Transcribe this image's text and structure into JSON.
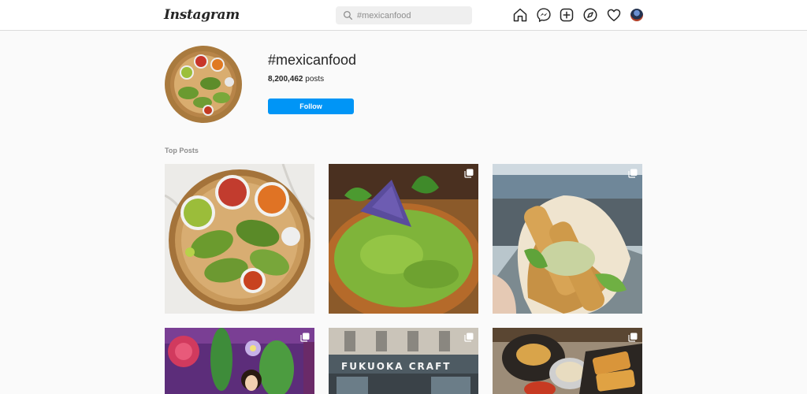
{
  "nav": {
    "logo": "Instagram",
    "search_placeholder": "#mexicanfood",
    "icons": [
      "home-icon",
      "messenger-icon",
      "new-post-icon",
      "explore-icon",
      "activity-heart-icon",
      "profile-avatar"
    ]
  },
  "header": {
    "title": "#mexicanfood",
    "post_count": "8,200,462",
    "post_count_label": "posts",
    "follow_label": "Follow"
  },
  "section": {
    "title": "Top Posts"
  },
  "posts": [
    {
      "subject": "taco platter with salsas and guacamole",
      "multi": false
    },
    {
      "subject": "guacamole bowl with blue tortilla chip",
      "multi": true
    },
    {
      "subject": "fish taco held over harbor",
      "multi": true
    },
    {
      "subject": "cactus and flower mural with person",
      "multi": true
    },
    {
      "subject": "Fukuoka Craft storefront",
      "sign_text": "FUKUOKA CRAFT",
      "multi": true
    },
    {
      "subject": "fried appetizers with dipping sauce",
      "multi": true
    }
  ],
  "colors": {
    "accent": "#0095f6",
    "background": "#fafafa",
    "border": "#dbdbdb"
  }
}
